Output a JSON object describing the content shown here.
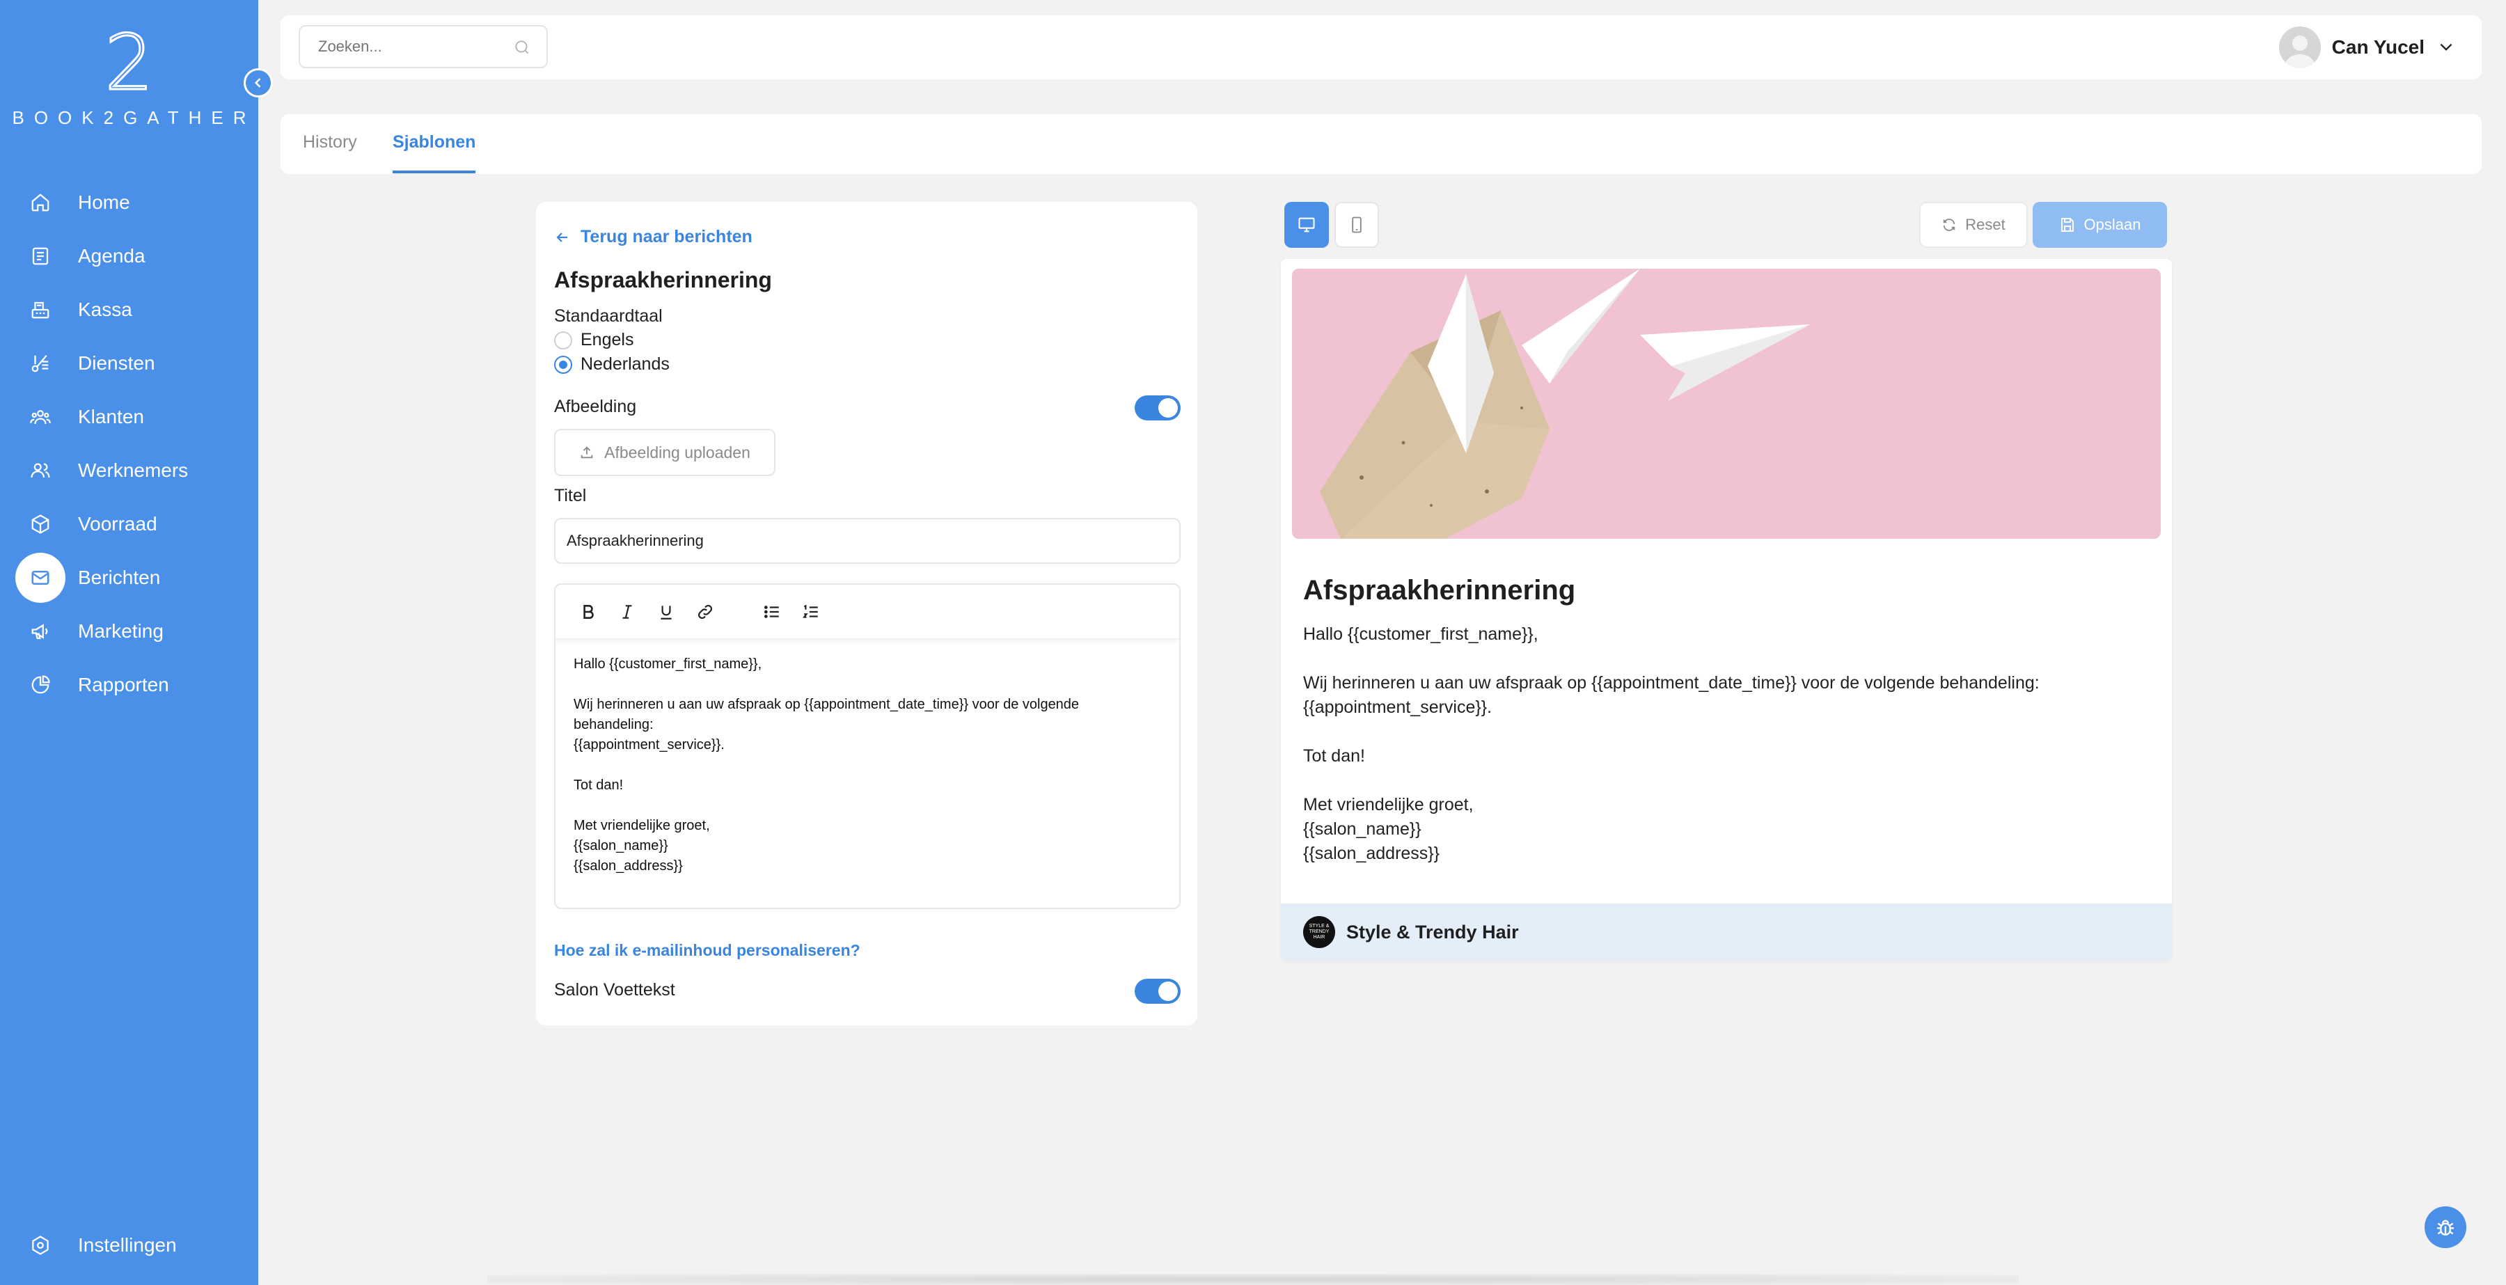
{
  "brand": {
    "logo_mark": "2",
    "logo_text": "BOOK2GATHER"
  },
  "sidebar": {
    "items": [
      {
        "label": "Home",
        "icon": "home-icon"
      },
      {
        "label": "Agenda",
        "icon": "calendar-icon"
      },
      {
        "label": "Kassa",
        "icon": "cash-register-icon"
      },
      {
        "label": "Diensten",
        "icon": "scissors-icon"
      },
      {
        "label": "Klanten",
        "icon": "customers-icon"
      },
      {
        "label": "Werknemers",
        "icon": "employees-icon"
      },
      {
        "label": "Voorraad",
        "icon": "box-icon"
      },
      {
        "label": "Berichten",
        "icon": "mail-icon",
        "active": true
      },
      {
        "label": "Marketing",
        "icon": "megaphone-icon"
      },
      {
        "label": "Rapporten",
        "icon": "pie-chart-icon"
      }
    ],
    "settings_label": "Instellingen"
  },
  "topbar": {
    "search_placeholder": "Zoeken...",
    "user_name": "Can Yucel"
  },
  "tabs": [
    {
      "label": "History"
    },
    {
      "label": "Sjablonen",
      "active": true
    }
  ],
  "editor": {
    "back_label": "Terug naar berichten",
    "title": "Afspraakherinnering",
    "language_label": "Standaardtaal",
    "languages": [
      {
        "label": "Engels",
        "selected": false
      },
      {
        "label": "Nederlands",
        "selected": true
      }
    ],
    "image_label": "Afbeelding",
    "image_enabled": true,
    "upload_label": "Afbeelding uploaden",
    "title_label": "Titel",
    "title_value": "Afspraakherinnering",
    "body_lines": [
      "Hallo {{customer_first_name}},",
      "",
      "Wij herinneren u aan uw afspraak op {{appointment_date_time}} voor de volgende behandeling:",
      "{{appointment_service}}.",
      "",
      "Tot dan!",
      "",
      "Met vriendelijke groet,",
      "{{salon_name}}",
      "{{salon_address}}"
    ],
    "help_link": "Hoe zal ik e-mailinhoud personaliseren?",
    "footer_label": "Salon Voettekst",
    "footer_enabled": true
  },
  "preview": {
    "reset_label": "Reset",
    "save_label": "Opslaan",
    "title": "Afspraakherinnering",
    "body_lines": [
      "Hallo {{customer_first_name}},",
      "",
      "Wij herinneren u aan uw afspraak op {{appointment_date_time}} voor de volgende behandeling:",
      "{{appointment_service}}.",
      "",
      "Tot dan!",
      "",
      "Met vriendelijke groet,",
      "{{salon_name}}",
      "{{salon_address}}"
    ],
    "salon_name": "Style & Trendy Hair",
    "salon_logo_text": "STYLE & TRENDY HAIR"
  },
  "colors": {
    "primary": "#4a90e8",
    "link": "#3a85e0",
    "hero_bg": "#f1c3d2",
    "footer_bg": "#e3eef9"
  }
}
